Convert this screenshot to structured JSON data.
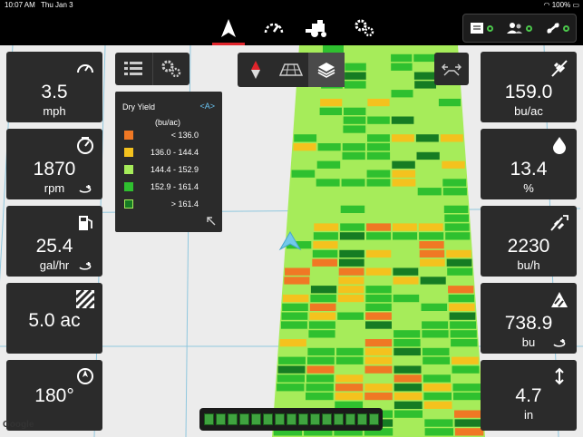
{
  "status_bar": {
    "time": "10:07 AM",
    "date": "Thu Jan 3",
    "battery": "100%"
  },
  "nav": {
    "tabs": [
      {
        "icon": "guidance-arrow-icon",
        "active": true
      },
      {
        "icon": "gauge-icon",
        "active": false
      },
      {
        "icon": "combine-icon",
        "active": false
      },
      {
        "icon": "settings-gears-icon",
        "active": false
      }
    ]
  },
  "system_status": {
    "items": [
      {
        "icon": "notes-icon",
        "status": "ok"
      },
      {
        "icon": "users-icon",
        "status": "ok"
      },
      {
        "icon": "connection-icon",
        "status": "ok"
      }
    ],
    "ok_color": "#4cc84c"
  },
  "left_tiles": [
    {
      "value": "3.5",
      "unit": "mph",
      "icon": "speedometer-icon"
    },
    {
      "value": "1870",
      "unit": "rpm",
      "icon": "engine-rpm-icon",
      "sub_icon": "cycle-icon"
    },
    {
      "value": "25.4",
      "unit": "gal/hr",
      "icon": "fuel-pump-icon",
      "sub_icon": "cycle-icon"
    },
    {
      "value": "5.0 ac",
      "unit": "",
      "icon": "area-hatch-icon"
    },
    {
      "value": "180°",
      "unit": "",
      "icon": "compass-icon"
    }
  ],
  "right_tiles": [
    {
      "value": "159.0",
      "unit": "bu/ac",
      "icon": "grain-yield-icon"
    },
    {
      "value": "13.4",
      "unit": "%",
      "icon": "moisture-drop-icon"
    },
    {
      "value": "2230",
      "unit": "bu/h",
      "icon": "harvest-rate-icon"
    },
    {
      "value": "738.9",
      "unit": "bu",
      "icon": "grain-tank-icon",
      "sub_icon": "cycle-icon"
    },
    {
      "value": "4.7",
      "unit": "in",
      "icon": "header-height-icon"
    }
  ],
  "map_controls": {
    "left": [
      {
        "icon": "list-icon"
      },
      {
        "icon": "settings-gears-icon"
      }
    ],
    "center": [
      {
        "icon": "north-compass-icon"
      },
      {
        "icon": "perspective-grid-icon"
      },
      {
        "icon": "layers-icon",
        "active": true
      }
    ],
    "right": [
      {
        "icon": "swath-width-icon"
      }
    ]
  },
  "legend": {
    "title": "Dry Yield",
    "units": "(bu/ac)",
    "ranges": [
      {
        "label": "< 136.0",
        "color": "#f07824"
      },
      {
        "label": "136.0 - 144.4",
        "color": "#f4c21e"
      },
      {
        "label": "144.4 - 152.9",
        "color": "#a6ec5a"
      },
      {
        "label": "152.9 - 161.4",
        "color": "#2fc02f"
      },
      {
        "label": "> 161.4",
        "color": "#167c23"
      }
    ]
  },
  "lightbar": {
    "segments": 15,
    "color": "#3fa33f"
  },
  "attribution": "Google",
  "yield_colors": [
    "#f07824",
    "#f4c21e",
    "#a6ec5a",
    "#2fc02f",
    "#167c23"
  ]
}
